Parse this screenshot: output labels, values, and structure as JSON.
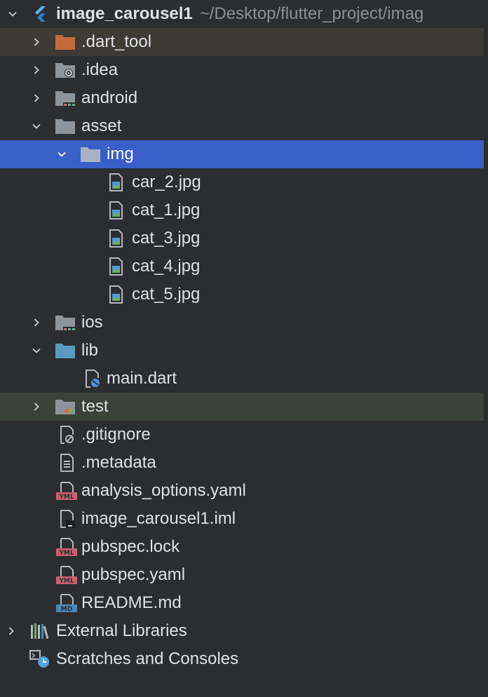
{
  "project": {
    "name": "image_carousel1",
    "path": "~/Desktop/flutter_project/imag"
  },
  "tree": {
    "dart_tool": ".dart_tool",
    "idea": ".idea",
    "android": "android",
    "asset": "asset",
    "img": "img",
    "files_img": [
      "car_2.jpg",
      "cat_1.jpg",
      "cat_3.jpg",
      "cat_4.jpg",
      "cat_5.jpg"
    ],
    "ios": "ios",
    "lib": "lib",
    "main_dart": "main.dart",
    "test": "test",
    "gitignore": ".gitignore",
    "metadata": ".metadata",
    "analysis_options": "analysis_options.yaml",
    "iml": "image_carousel1.iml",
    "pubspec_lock": "pubspec.lock",
    "pubspec_yaml": "pubspec.yaml",
    "readme": "README.md",
    "external_libraries": "External Libraries",
    "scratches": "Scratches and Consoles"
  },
  "badges": {
    "yml": "YML",
    "md": "MD"
  },
  "colors": {
    "background": "#2b2d30",
    "selected": "#3a5fc8",
    "excluded_folder": "#c36a3a",
    "folder": "#8e949c",
    "source_folder": "#5a9ac2",
    "yml_badge": "#c95f6d",
    "md_badge": "#4b87b8"
  }
}
